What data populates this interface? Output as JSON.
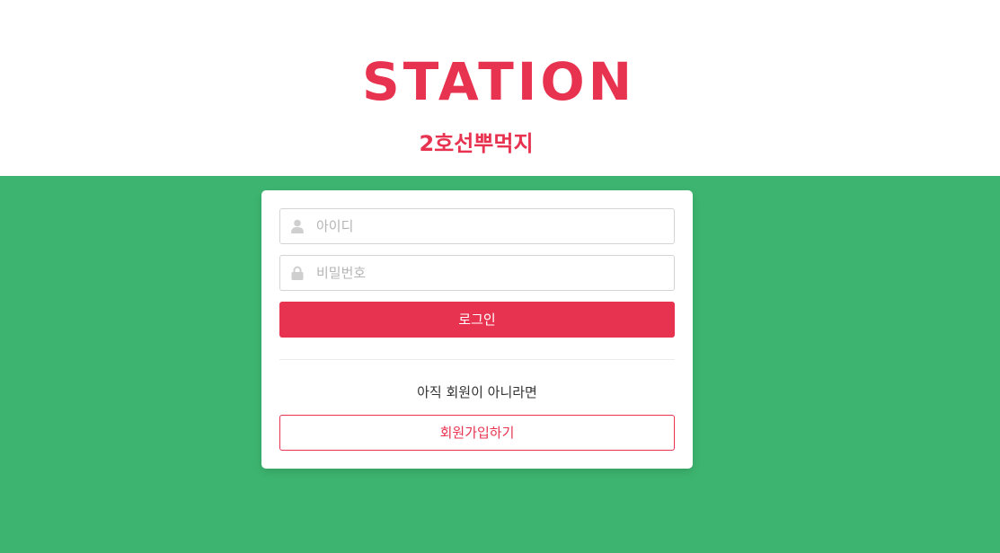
{
  "header": {
    "logo_text": "STATION",
    "subtitle": "2호선뿌먹지"
  },
  "login_form": {
    "id_field": {
      "placeholder": "아이디",
      "value": "",
      "icon": "user-icon"
    },
    "password_field": {
      "placeholder": "비밀번호",
      "value": "",
      "icon": "lock-icon"
    },
    "login_button": "로그인",
    "signup_prompt": "아직 회원이 아니라면",
    "signup_button": "회원가입하기"
  },
  "colors": {
    "brand": "#e83350",
    "background": "#3db570",
    "card": "#ffffff",
    "icon": "#cfcfcf"
  }
}
